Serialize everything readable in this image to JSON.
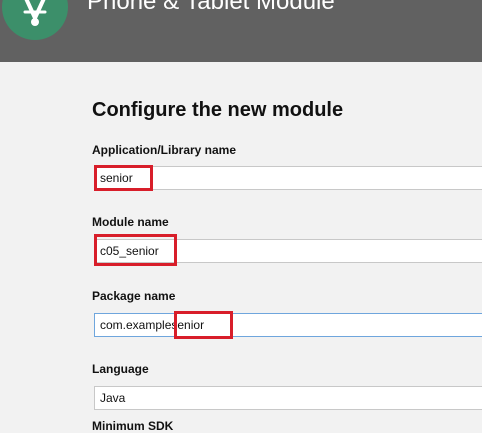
{
  "header": {
    "title": "Phone & Tablet Module",
    "logo_icon": "android-studio-icon"
  },
  "form": {
    "heading": "Configure the new module",
    "app_name": {
      "label": "Application/Library name",
      "value": "senior"
    },
    "module_name": {
      "label": "Module name",
      "value": "c05_senior"
    },
    "package_name": {
      "label": "Package name",
      "value_prefix": "com.example",
      "value_suffix": "senior"
    },
    "language": {
      "label": "Language",
      "value": "Java"
    },
    "min_sdk": {
      "label": "Minimum SDK"
    }
  },
  "highlight_color": "#d81e2a"
}
